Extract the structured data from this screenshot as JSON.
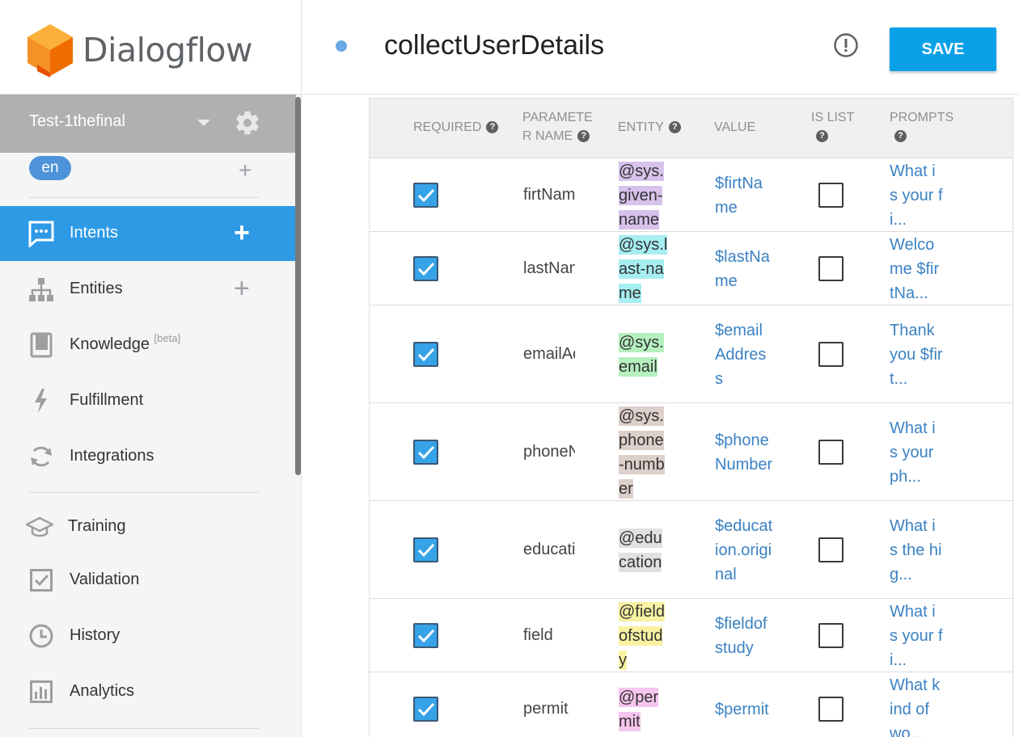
{
  "app": {
    "name": "Dialogflow"
  },
  "sidebar": {
    "agent_name": "Test-1thefinal",
    "language": "en",
    "nav": [
      {
        "label": "Intents",
        "icon": "chat-bubble-icon",
        "active": true
      },
      {
        "label": "Entities",
        "icon": "hierarchy-icon"
      },
      {
        "label": "Knowledge",
        "badge": "[beta]",
        "icon": "book-icon"
      },
      {
        "label": "Fulfillment",
        "icon": "lightning-icon"
      },
      {
        "label": "Integrations",
        "icon": "sync-icon"
      },
      {
        "label": "Training",
        "icon": "graduation-cap-icon"
      },
      {
        "label": "Validation",
        "icon": "check-box-icon"
      },
      {
        "label": "History",
        "icon": "clock-icon"
      },
      {
        "label": "Analytics",
        "icon": "bar-chart-icon"
      }
    ]
  },
  "header": {
    "intent_name": "collectUserDetails",
    "save_label": "SAVE"
  },
  "table": {
    "headers": {
      "required": "REQUIRED",
      "param_name": "PARAMETE R NAME",
      "entity": "ENTITY",
      "value": "VALUE",
      "is_list": "IS LIST",
      "prompts": "PROMPTS"
    },
    "rows": [
      {
        "required": true,
        "param": "firtNam",
        "entity": "@sys.given-name",
        "entity_color": "#d7c2ec",
        "value": "$firtName",
        "is_list": false,
        "prompt": "What is your fi..."
      },
      {
        "required": true,
        "param": "lastName",
        "entity": "@sys.last-name",
        "entity_color": "#a6eef2",
        "value": "$lastName",
        "is_list": false,
        "prompt": "Welcome $firtNa..."
      },
      {
        "required": true,
        "param": "emailAddress",
        "entity": "@sys.email",
        "entity_color": "#b6f0bf",
        "value": "$emailAddress",
        "is_list": false,
        "prompt": "Thank you $firt..."
      },
      {
        "required": true,
        "param": "phoneNumber",
        "entity": "@sys.phone-number",
        "entity_color": "#ddcfca",
        "value": "$phoneNumber",
        "is_list": false,
        "prompt": "What is your ph..."
      },
      {
        "required": true,
        "param": "education",
        "entity": "@education",
        "entity_color": "#dfe1e3",
        "value": "$education.original",
        "is_list": false,
        "prompt": "What is the hig..."
      },
      {
        "required": true,
        "param": "field",
        "entity": "@fieldofstudy",
        "entity_color": "#f8f2a2",
        "value": "$fieldofstudy",
        "is_list": false,
        "prompt": "What is your fi..."
      },
      {
        "required": true,
        "param": "permit",
        "entity": "@permit",
        "entity_color": "#f6c5ee",
        "value": "$permit",
        "is_list": false,
        "prompt": "What kind of wo..."
      }
    ]
  }
}
